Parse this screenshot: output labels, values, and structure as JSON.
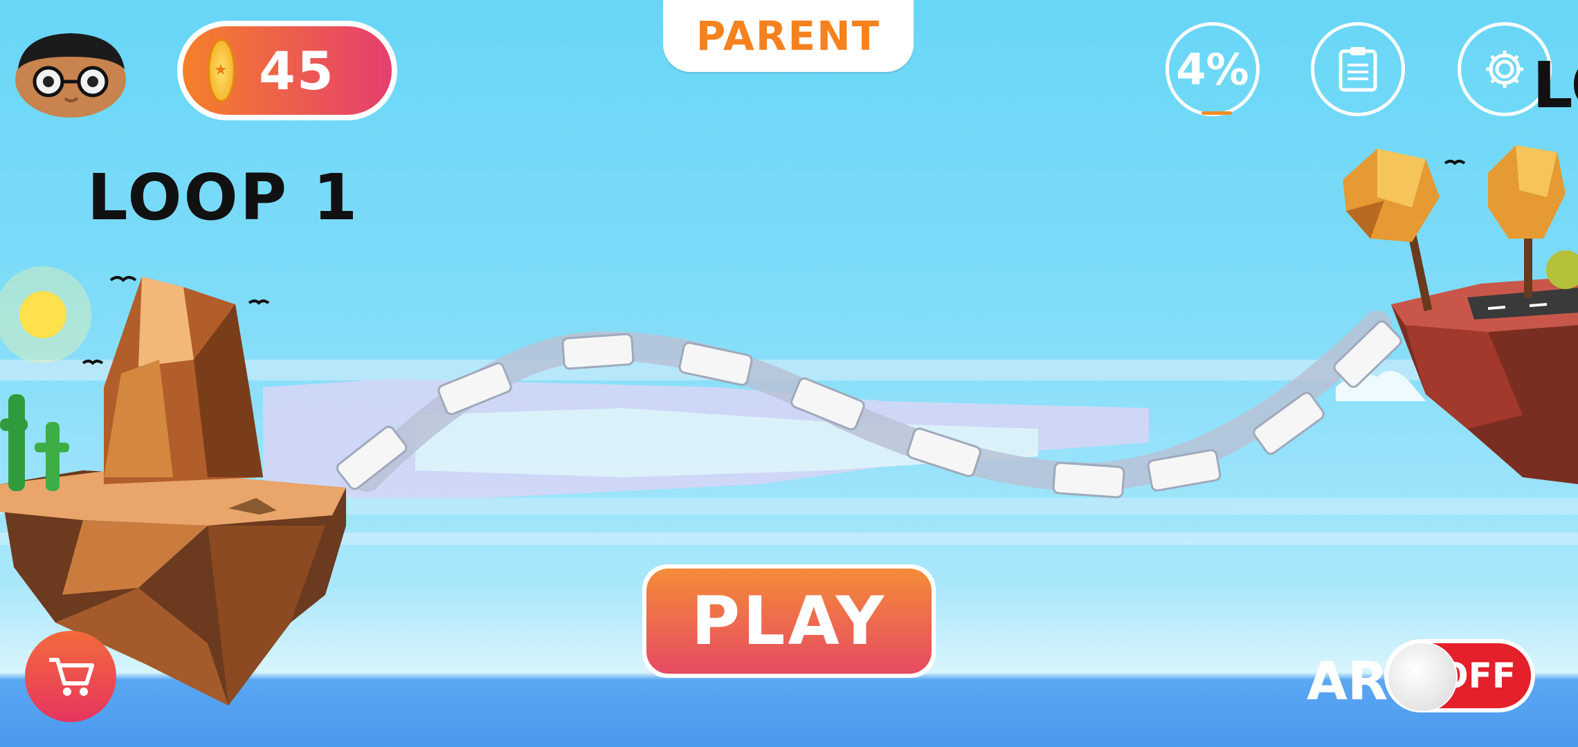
{
  "hud": {
    "coins": "45",
    "parent_label": "PARENT",
    "progress_label": "4%",
    "progress_fraction": 0.04
  },
  "map": {
    "current_loop_title": "LOOP 1",
    "next_loop_title_partial": "LO",
    "path_segments": 11
  },
  "actions": {
    "play_label": "PLAY",
    "ar_label": "AR",
    "ar_state": "OFF"
  },
  "colors": {
    "accent_orange": "#f5821f",
    "button_gradient_top": "#f48c38",
    "button_gradient_bottom": "#e64a63",
    "toggle_off": "#e4202a"
  },
  "icons": {
    "coin": "coin-icon",
    "clipboard": "clipboard-icon",
    "settings": "gear-icon",
    "cart": "shopping-cart-icon"
  }
}
